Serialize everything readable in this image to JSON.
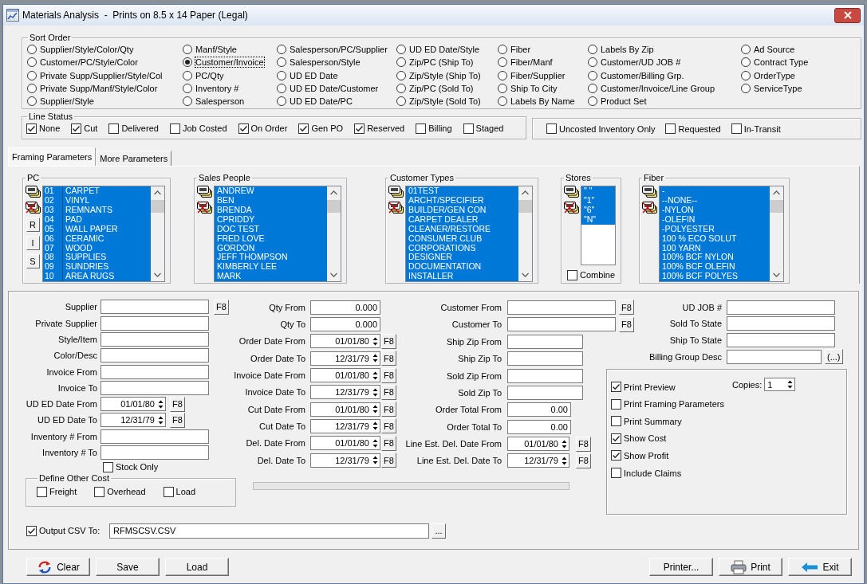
{
  "window": {
    "title": "Materials Analysis  -  Prints on 8.5 x 14 Paper (Legal)"
  },
  "sort_order": {
    "label": "Sort Order",
    "columns": [
      {
        "options": [
          {
            "label": "Supplier/Style/Color/Qty",
            "selected": false
          },
          {
            "label": "Customer/PC/Style/Color",
            "selected": false
          },
          {
            "label": "Private Supp/Supplier/Style/Col",
            "selected": false
          },
          {
            "label": "Private Supp/Manf/Style/Color",
            "selected": false
          },
          {
            "label": "Supplier/Style",
            "selected": false
          }
        ]
      },
      {
        "options": [
          {
            "label": "Manf/Style",
            "selected": false
          },
          {
            "label": "Customer/Invoice",
            "selected": true
          },
          {
            "label": "PC/Qty",
            "selected": false
          },
          {
            "label": "Inventory #",
            "selected": false
          },
          {
            "label": "Salesperson",
            "selected": false
          }
        ]
      },
      {
        "options": [
          {
            "label": "Salesperson/PC/Supplier",
            "selected": false
          },
          {
            "label": "Salesperson/Style",
            "selected": false
          },
          {
            "label": "UD ED Date",
            "selected": false
          },
          {
            "label": "UD ED Date/Customer",
            "selected": false
          },
          {
            "label": "UD ED Date/PC",
            "selected": false
          }
        ]
      },
      {
        "options": [
          {
            "label": "UD ED Date/Style",
            "selected": false
          },
          {
            "label": "Zip/PC (Ship To)",
            "selected": false
          },
          {
            "label": "Zip/Style (Ship To)",
            "selected": false
          },
          {
            "label": "Zip/PC (Sold To)",
            "selected": false
          },
          {
            "label": "Zip/Style (Sold To)",
            "selected": false
          }
        ]
      },
      {
        "options": [
          {
            "label": "Fiber",
            "selected": false
          },
          {
            "label": "Fiber/Manf",
            "selected": false
          },
          {
            "label": "Fiber/Supplier",
            "selected": false
          },
          {
            "label": "Ship To City",
            "selected": false
          },
          {
            "label": "Labels By Name",
            "selected": false
          }
        ]
      },
      {
        "options": [
          {
            "label": "Labels By Zip",
            "selected": false
          },
          {
            "label": "Customer/UD JOB #",
            "selected": false
          },
          {
            "label": "Customer/Billing Grp.",
            "selected": false
          },
          {
            "label": "Customer/Invoice/Line Group",
            "selected": false
          },
          {
            "label": "Product Set",
            "selected": false
          }
        ]
      },
      {
        "options": [
          {
            "label": "Ad Source",
            "selected": false
          },
          {
            "label": "Contract Type",
            "selected": false
          },
          {
            "label": "OrderType",
            "selected": false
          },
          {
            "label": "ServiceType",
            "selected": false
          }
        ]
      }
    ]
  },
  "line_status": {
    "label": "Line Status",
    "options": [
      {
        "label": "None",
        "checked": true
      },
      {
        "label": "Cut",
        "checked": true
      },
      {
        "label": "Delivered",
        "checked": false
      },
      {
        "label": "Job Costed",
        "checked": false
      },
      {
        "label": "On Order",
        "checked": true
      },
      {
        "label": "Gen PO",
        "checked": true
      },
      {
        "label": "Reserved",
        "checked": true
      },
      {
        "label": "Billing",
        "checked": false
      },
      {
        "label": "Staged",
        "checked": false
      }
    ]
  },
  "other_status": {
    "options": [
      {
        "label": "Uncosted Inventory Only",
        "checked": false
      },
      {
        "label": "Requested",
        "checked": false
      },
      {
        "label": "In-Transit",
        "checked": false
      }
    ]
  },
  "tabs": [
    {
      "label": "Framing Parameters",
      "selected": true
    },
    {
      "label": "More Parameters",
      "selected": false
    }
  ],
  "list_groups": [
    {
      "title": "PC",
      "kind": "coded",
      "side_buttons": [
        "R",
        "I",
        "S"
      ],
      "items": [
        {
          "code": "01",
          "name": "CARPET",
          "selected": true
        },
        {
          "code": "02",
          "name": "VINYL",
          "selected": true
        },
        {
          "code": "03",
          "name": "REMNANTS",
          "selected": true
        },
        {
          "code": "04",
          "name": "PAD",
          "selected": true
        },
        {
          "code": "05",
          "name": "WALL PAPER",
          "selected": true
        },
        {
          "code": "06",
          "name": "CERAMIC",
          "selected": true
        },
        {
          "code": "07",
          "name": "WOOD",
          "selected": true
        },
        {
          "code": "08",
          "name": "SUPPLIES",
          "selected": true
        },
        {
          "code": "09",
          "name": "SUNDRIES",
          "selected": true
        },
        {
          "code": "10",
          "name": "AREA RUGS",
          "selected": true
        }
      ]
    },
    {
      "title": "Sales People",
      "kind": "plain",
      "items": [
        {
          "label": "ANDREW",
          "selected": true
        },
        {
          "label": "BEN",
          "selected": true
        },
        {
          "label": "BRENDA",
          "selected": true
        },
        {
          "label": "CPRIDDY",
          "selected": true
        },
        {
          "label": "DOC TEST",
          "selected": true
        },
        {
          "label": "FRED LOVE",
          "selected": true
        },
        {
          "label": "GORDON",
          "selected": true
        },
        {
          "label": "JEFF THOMPSON",
          "selected": true
        },
        {
          "label": "KIMBERLY LEE",
          "selected": true
        },
        {
          "label": "MARK",
          "selected": true
        }
      ]
    },
    {
      "title": "Customer Types",
      "kind": "plain",
      "items": [
        {
          "label": "01TEST",
          "selected": true
        },
        {
          "label": "ARCHT/SPECIFIER",
          "selected": true
        },
        {
          "label": "BUILDER/GEN CON",
          "selected": true
        },
        {
          "label": "CARPET DEALER",
          "selected": true
        },
        {
          "label": "CLEANER/RESTORE",
          "selected": true
        },
        {
          "label": "CONSUMER CLUB",
          "selected": true
        },
        {
          "label": "CORPORATIONS",
          "selected": true
        },
        {
          "label": "DESIGNER",
          "selected": true
        },
        {
          "label": "DOCUMENTATION",
          "selected": true
        },
        {
          "label": "INSTALLER",
          "selected": true
        }
      ]
    },
    {
      "title": "Stores",
      "kind": "compact",
      "items": [
        {
          "label": "\" \"",
          "selected": true
        },
        {
          "label": "\"1\"",
          "selected": true
        },
        {
          "label": "\"6\"",
          "selected": true
        },
        {
          "label": "\"N\"",
          "selected": true
        }
      ],
      "combine": {
        "label": "Combine",
        "checked": false
      }
    },
    {
      "title": "Fiber",
      "kind": "plain",
      "items": [
        {
          "label": "-",
          "selected": true
        },
        {
          "label": "--NONE--",
          "selected": true
        },
        {
          "label": "-NYLON",
          "selected": true
        },
        {
          "label": "-OLEFIN",
          "selected": true
        },
        {
          "label": "-POLYESTER",
          "selected": true
        },
        {
          "label": "100 % ECO SOLUT",
          "selected": true
        },
        {
          "label": "100 YARN",
          "selected": true
        },
        {
          "label": "100% BCF NYLON",
          "selected": true
        },
        {
          "label": "100% BCF OLEFIN",
          "selected": true
        },
        {
          "label": "100% BCF POLYES",
          "selected": true
        }
      ]
    }
  ],
  "filters": {
    "columns": [
      {
        "fields": [
          {
            "label": "Supplier",
            "kind": "text",
            "button": "F8"
          },
          {
            "label": "Private Supplier",
            "kind": "text"
          },
          {
            "label": "Style/Item",
            "kind": "text"
          },
          {
            "label": "Color/Desc",
            "kind": "text"
          },
          {
            "label": "Invoice From",
            "kind": "text"
          },
          {
            "label": "Invoice To",
            "kind": "text"
          },
          {
            "label": "UD ED Date From",
            "kind": "spin",
            "value": "01/01/80",
            "button": "F8"
          },
          {
            "label": "UD ED Date To",
            "kind": "spin",
            "value": "12/31/79",
            "button": "F8"
          },
          {
            "label": "Inventory # From",
            "kind": "text"
          },
          {
            "label": "Inventory # To",
            "kind": "text"
          }
        ]
      },
      {
        "fields": [
          {
            "label": "Qty From",
            "kind": "number",
            "value": "0.000"
          },
          {
            "label": "Qty To",
            "kind": "number",
            "value": "0.000"
          },
          {
            "label": "Order Date From",
            "kind": "spin",
            "value": "01/01/80",
            "button": "F8"
          },
          {
            "label": "Order Date To",
            "kind": "spin",
            "value": "12/31/79",
            "button": "F8"
          },
          {
            "label": "Invoice Date From",
            "kind": "spin",
            "value": "01/01/80",
            "button": "F8"
          },
          {
            "label": "Invoice Date To",
            "kind": "spin",
            "value": "12/31/79",
            "button": "F8"
          },
          {
            "label": "Cut Date From",
            "kind": "spin",
            "value": "01/01/80",
            "button": "F8"
          },
          {
            "label": "Cut Date To",
            "kind": "spin",
            "value": "12/31/79",
            "button": "F8"
          },
          {
            "label": "Del. Date From",
            "kind": "spin",
            "value": "01/01/80",
            "button": "F8"
          },
          {
            "label": "Del. Date To",
            "kind": "spin",
            "value": "12/31/79",
            "button": "F8"
          }
        ]
      },
      {
        "fields": [
          {
            "label": "Customer From",
            "kind": "text",
            "button": "F8"
          },
          {
            "label": "Customer To",
            "kind": "text",
            "button": "F8"
          },
          {
            "label": "Ship Zip From",
            "kind": "short"
          },
          {
            "label": "Ship Zip To",
            "kind": "short"
          },
          {
            "label": "Sold Zip From",
            "kind": "short"
          },
          {
            "label": "Sold Zip To",
            "kind": "short"
          },
          {
            "label": "Order Total From",
            "kind": "number",
            "value": "0.00"
          },
          {
            "label": "Order Total To",
            "kind": "number",
            "value": "0.00"
          },
          {
            "label": "Line Est. Del. Date From",
            "kind": "spin",
            "value": "01/01/80",
            "button": "F8"
          },
          {
            "label": "Line Est. Del. Date To",
            "kind": "spin",
            "value": "12/31/79",
            "button": "F8"
          }
        ]
      },
      {
        "fields": [
          {
            "label": "UD JOB #",
            "kind": "text"
          },
          {
            "label": "Sold To State",
            "kind": "text"
          },
          {
            "label": "Ship To State",
            "kind": "text"
          },
          {
            "label": "Billing Group Desc",
            "kind": "text",
            "button": "(...)"
          }
        ]
      }
    ],
    "stock_only": {
      "label": "Stock Only",
      "checked": false
    },
    "other_cost": {
      "label": "Define Other Cost",
      "options": [
        {
          "label": "Freight",
          "checked": false
        },
        {
          "label": "Overhead",
          "checked": false
        },
        {
          "label": "Load",
          "checked": false
        }
      ]
    },
    "progress": {
      "level": 0
    },
    "print_options": {
      "options": [
        {
          "label": "Print Preview",
          "checked": true
        },
        {
          "label": "Print Framing Parameters",
          "checked": false
        },
        {
          "label": "Print Summary",
          "checked": false
        },
        {
          "label": "Show Cost",
          "checked": true
        },
        {
          "label": "Show Profit",
          "checked": true
        },
        {
          "label": "Include Claims",
          "checked": false
        }
      ],
      "copies": {
        "label": "Copies:",
        "value": "1"
      }
    }
  },
  "output_csv": {
    "label": "Output CSV To:",
    "checked": true,
    "value": "RFMSCSV.CSV",
    "button": "..."
  },
  "button_bar": {
    "left": [
      {
        "label": "Clear",
        "kind": "clear"
      },
      {
        "label": "Save",
        "kind": "plain"
      },
      {
        "label": "Load",
        "kind": "plain"
      }
    ],
    "right": [
      {
        "label": "Printer...",
        "kind": "plain"
      },
      {
        "label": "Print",
        "kind": "print"
      },
      {
        "label": "Exit",
        "kind": "exit"
      }
    ]
  }
}
